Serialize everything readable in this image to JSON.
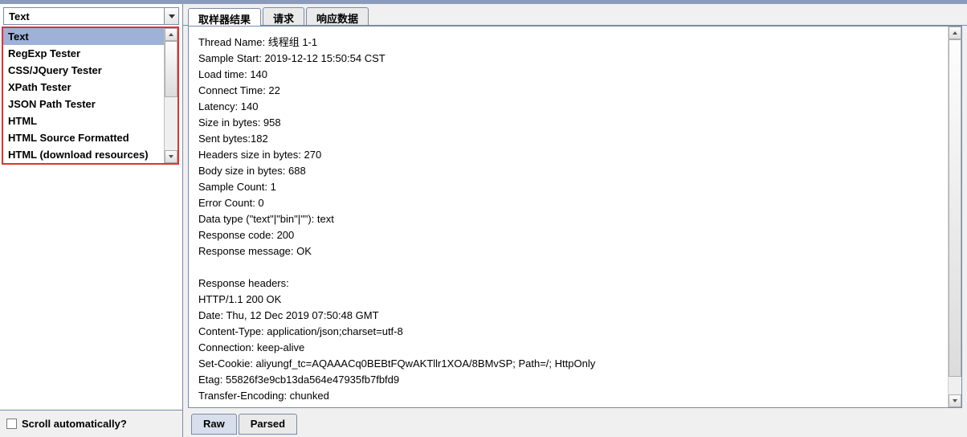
{
  "dropdown": {
    "selected": "Text",
    "items": [
      "Text",
      "RegExp Tester",
      "CSS/JQuery Tester",
      "XPath Tester",
      "JSON Path Tester",
      "HTML",
      "HTML Source Formatted",
      "HTML (download resources)"
    ]
  },
  "scroll_auto_label": "Scroll automatically?",
  "tabs": {
    "sampler": "取样器结果",
    "request": "请求",
    "response": "响应数据"
  },
  "result_lines": [
    "Thread Name: 线程组 1-1",
    "Sample Start: 2019-12-12 15:50:54 CST",
    "Load time: 140",
    "Connect Time: 22",
    "Latency: 140",
    "Size in bytes: 958",
    "Sent bytes:182",
    "Headers size in bytes: 270",
    "Body size in bytes: 688",
    "Sample Count: 1",
    "Error Count: 0",
    "Data type (\"text\"|\"bin\"|\"\"): text",
    "Response code: 200",
    "Response message: OK",
    "",
    "Response headers:",
    "HTTP/1.1 200 OK",
    "Date: Thu, 12 Dec 2019 07:50:48 GMT",
    "Content-Type: application/json;charset=utf-8",
    "Connection: keep-alive",
    "Set-Cookie: aliyungf_tc=AQAAACq0BEBtFQwAKTllr1XOA/8BMvSP; Path=/; HttpOnly",
    "Etag: 55826f3e9cb13da564e47935fb7fbfd9",
    "Transfer-Encoding: chunked"
  ],
  "bottom_tabs": {
    "raw": "Raw",
    "parsed": "Parsed"
  }
}
